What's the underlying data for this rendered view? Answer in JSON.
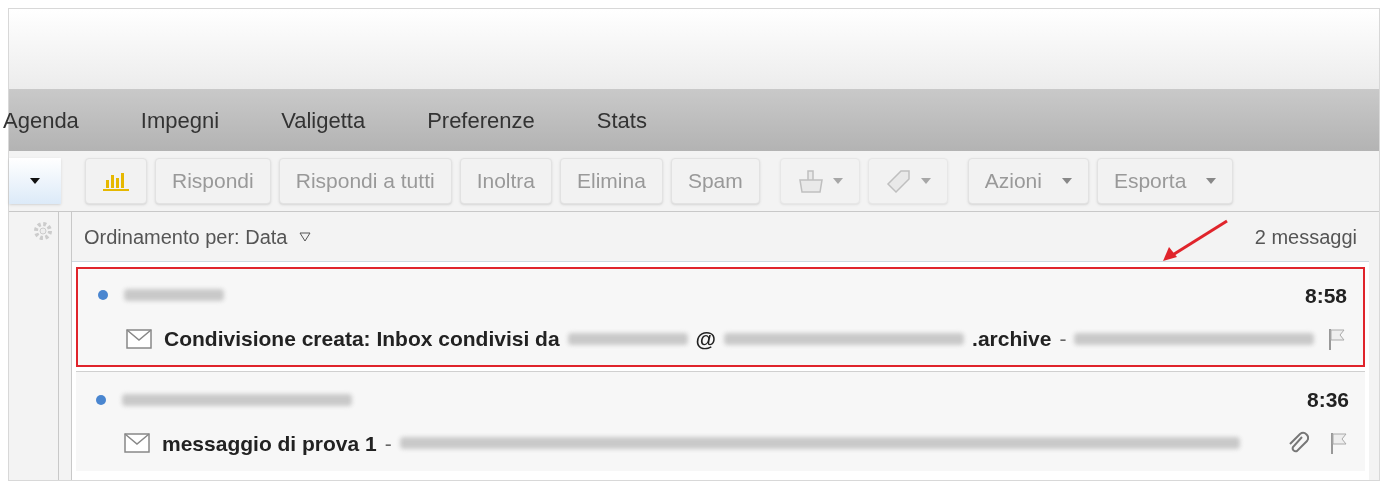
{
  "tabs": [
    {
      "label": "Agenda",
      "selected": false
    },
    {
      "label": "Impegni",
      "selected": false
    },
    {
      "label": "Valigetta",
      "selected": false
    },
    {
      "label": "Preferenze",
      "selected": false
    },
    {
      "label": "Stats",
      "selected": false
    }
  ],
  "toolbar": [
    {
      "kind": "chart",
      "disabled": false
    },
    {
      "kind": "text",
      "label": "Rispondi",
      "disabled": true
    },
    {
      "kind": "text",
      "label": "Rispondi a tutti",
      "disabled": true
    },
    {
      "kind": "text",
      "label": "Inoltra",
      "disabled": true
    },
    {
      "kind": "text",
      "label": "Elimina",
      "disabled": true
    },
    {
      "kind": "text",
      "label": "Spam",
      "disabled": true
    },
    {
      "kind": "move",
      "disabled": true
    },
    {
      "kind": "tag",
      "disabled": true
    },
    {
      "kind": "menu",
      "label": "Azioni",
      "disabled": true
    },
    {
      "kind": "menu",
      "label": "Esporta",
      "disabled": true
    }
  ],
  "list_header": {
    "sort_label": "Ordinamento per: Data",
    "count": "2 messaggi"
  },
  "messages": [
    {
      "time": "8:58",
      "highlighted": true,
      "attachment": false,
      "subject": [
        {
          "kind": "text",
          "text": "Condivisione creata: Inbox condivisi da"
        },
        {
          "kind": "redacted"
        },
        {
          "kind": "text",
          "text": "@"
        },
        {
          "kind": "redacted"
        },
        {
          "kind": "text",
          "text": ".archive"
        }
      ],
      "sep": "-"
    },
    {
      "time": "8:36",
      "highlighted": false,
      "attachment": true,
      "subject": [
        {
          "kind": "text",
          "text": "messaggio di prova 1"
        }
      ],
      "sep": "-"
    }
  ]
}
